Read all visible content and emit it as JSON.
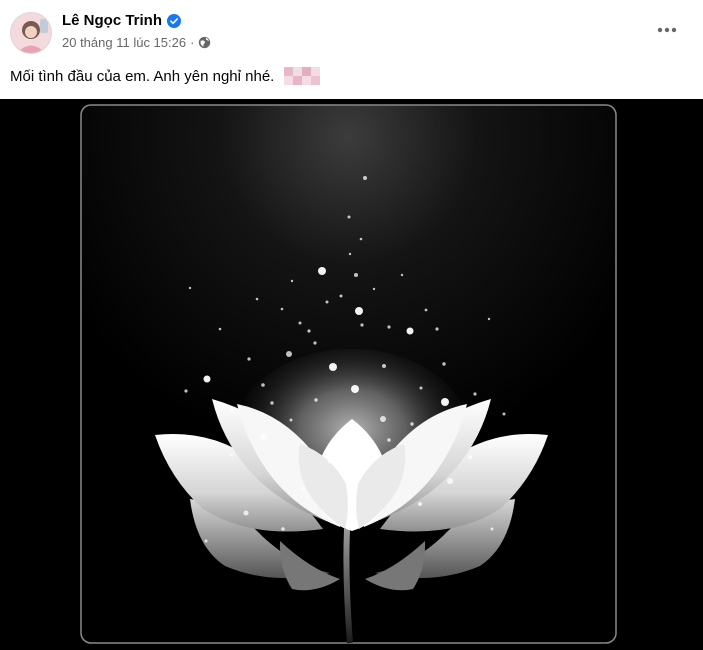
{
  "post": {
    "author": "Lê Ngọc Trinh",
    "timestamp": "20 tháng 11 lúc 15:26",
    "caption": "Mối tình đầu của em. Anh yên nghỉ nhé.",
    "privacy_icon": "globe-icon",
    "verified_icon": "verified-badge-icon",
    "more_icon": "more-options-icon"
  },
  "colors": {
    "verified": "#1877f2",
    "secondary_text": "#65676b",
    "photo_background": "#000000"
  }
}
